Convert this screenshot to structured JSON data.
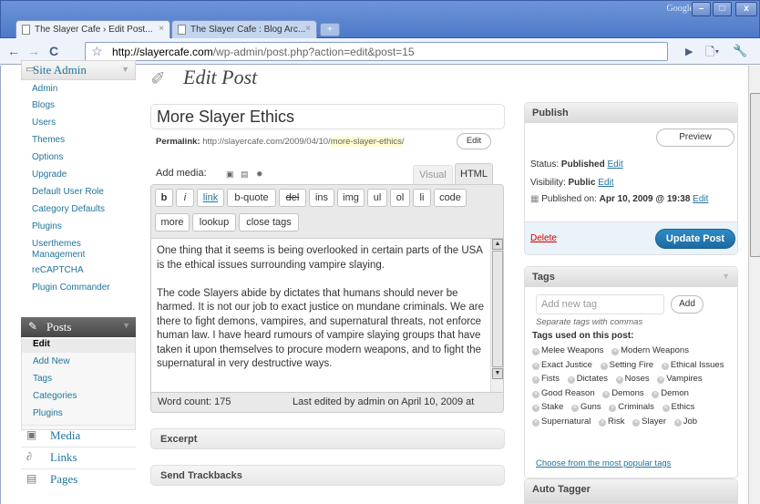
{
  "browser": {
    "tabs": [
      {
        "label": "The Slayer Cafe › Edit Post..."
      },
      {
        "label": "The Slayer Cafe : Blog Arc..."
      }
    ],
    "brand": "Google",
    "url_domain": "http://slayercafe.com",
    "url_path": "/wp-admin/post.php?action=edit&post=15"
  },
  "sidebar": {
    "site_admin": "Site Admin",
    "site_admin_items": [
      "Admin",
      "Blogs",
      "Users",
      "Themes",
      "Options",
      "Upgrade",
      "Default User Role",
      "Category Defaults",
      "Plugins",
      "Userthemes",
      "Management",
      "reCAPTCHA",
      "Plugin Commander"
    ],
    "posts_label": "Posts",
    "posts_items": [
      "Edit",
      "Add New",
      "Tags",
      "Categories",
      "Plugins"
    ],
    "media": "Media",
    "links": "Links",
    "pages": "Pages"
  },
  "main": {
    "heading": "Edit Post",
    "title_value": "More Slayer Ethics",
    "permalink_label": "Permalink:",
    "permalink_base": "http://slayercafe.com/2009/04/10/",
    "permalink_slug": "more-slayer-ethics",
    "permalink_end": "/",
    "permalink_edit": "Edit",
    "add_media": "Add media:",
    "tab_visual": "Visual",
    "tab_html": "HTML",
    "quicktags": [
      "b",
      "i",
      "link",
      "b-quote",
      "del",
      "ins",
      "img",
      "ul",
      "ol",
      "li",
      "code",
      "more",
      "lookup",
      "close tags"
    ],
    "body_p1": "One thing that it seems is being overlooked in certain parts of the USA is the ethical issues surrounding vampire slaying.",
    "body_p2": "The code Slayers abide by dictates that humans should never be harmed. It is not our job to exact justice on mundane criminals. We are there to fight demons, vampires, and supernatural threats, not enforce human law. I have heard rumours of vampire slaying groups that have taken it upon themselves to procure modern weapons, and to fight the supernatural in very destructive ways.",
    "word_count": "Word count: 175",
    "last_edited": "Last edited by admin on April 10, 2009 at",
    "excerpt": "Excerpt",
    "trackbacks": "Send Trackbacks"
  },
  "publish": {
    "title": "Publish",
    "preview": "Preview",
    "status_label": "Status:",
    "status_value": "Published",
    "visibility_label": "Visibility:",
    "visibility_value": "Public",
    "published_label": "Published on:",
    "published_value": "Apr 10, 2009 @ 19:38",
    "edit": "Edit",
    "delete": "Delete",
    "update": "Update Post"
  },
  "tags": {
    "title": "Tags",
    "placeholder": "Add new tag",
    "add": "Add",
    "hint": "Separate tags with commas",
    "used_label": "Tags used on this post:",
    "list": [
      "Melee Weapons",
      "Modern Weapons",
      "Exact Justice",
      "Setting Fire",
      "Ethical Issues",
      "Fists",
      "Dictates",
      "Noses",
      "Vampires",
      "Good Reason",
      "Demons",
      "Demon",
      "Stake",
      "Guns",
      "Criminals",
      "Ethics",
      "Supernatural",
      "Risk",
      "Slayer",
      "Job"
    ],
    "popular": "Choose from the most popular tags"
  },
  "auto_tagger": "Auto Tagger"
}
